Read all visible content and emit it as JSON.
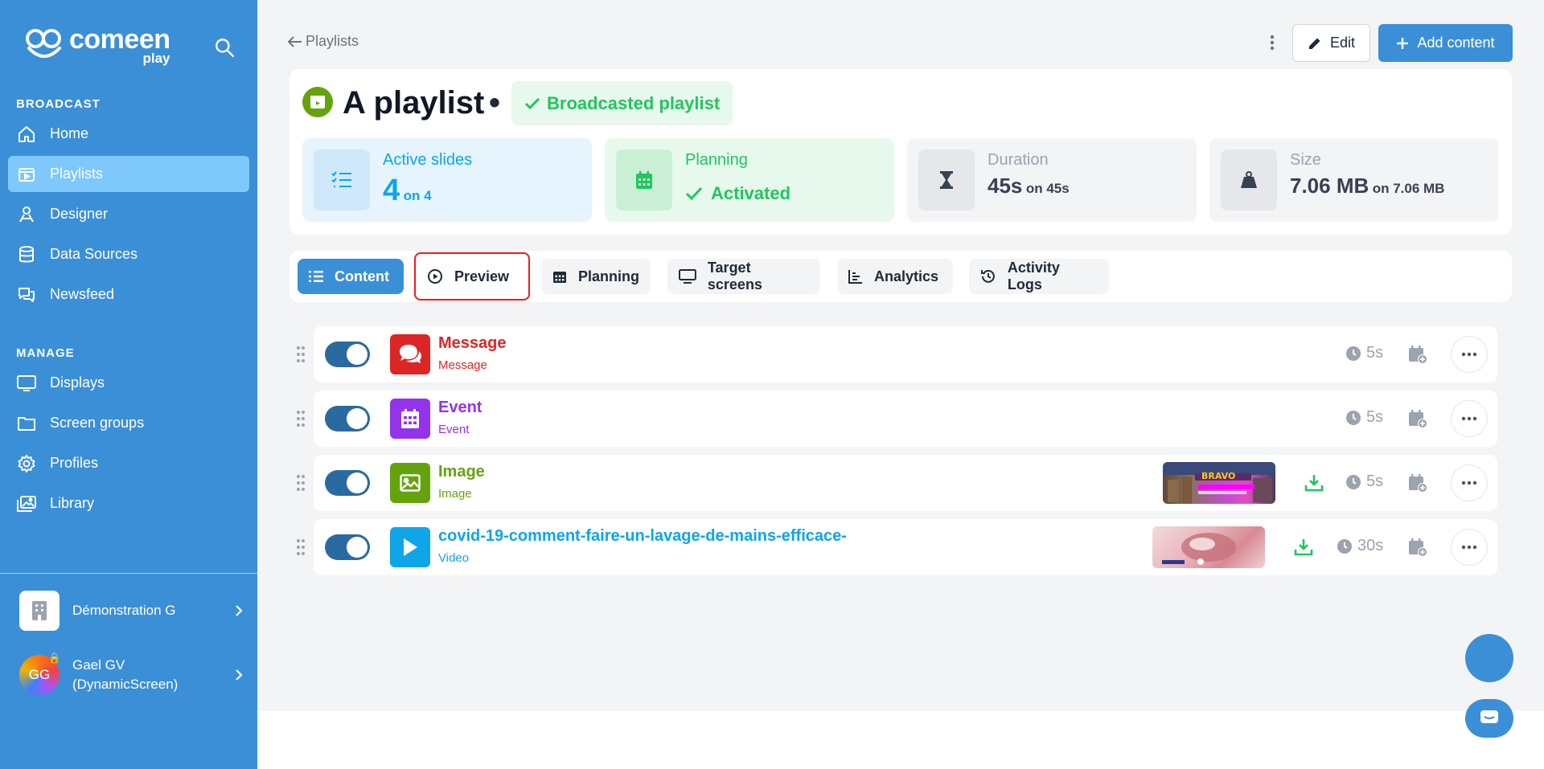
{
  "app": {
    "brand": "comeen",
    "brand_sub": "play"
  },
  "sidebar": {
    "broadcast_label": "BROADCAST",
    "manage_label": "MANAGE",
    "broadcast_items": [
      {
        "label": "Home",
        "icon": "home-icon"
      },
      {
        "label": "Playlists",
        "icon": "playlist-icon",
        "active": true
      },
      {
        "label": "Designer",
        "icon": "designer-icon"
      },
      {
        "label": "Data Sources",
        "icon": "database-icon"
      },
      {
        "label": "Newsfeed",
        "icon": "newsfeed-icon"
      }
    ],
    "manage_items": [
      {
        "label": "Displays",
        "icon": "monitor-icon"
      },
      {
        "label": "Screen groups",
        "icon": "folder-icon"
      },
      {
        "label": "Profiles",
        "icon": "gear-icon"
      },
      {
        "label": "Library",
        "icon": "images-icon"
      }
    ],
    "organization": "Démonstration G",
    "user": {
      "initials": "GG",
      "name_line1": "Gael GV",
      "name_line2": "(DynamicScreen)"
    }
  },
  "header": {
    "back_label": "Playlists",
    "edit_label": "Edit",
    "add_label": "Add content"
  },
  "playlist": {
    "title": "A playlist",
    "separator": "•",
    "status": "Broadcasted playlist",
    "stats": {
      "active": {
        "label": "Active slides",
        "value": "4",
        "suffix": "on 4"
      },
      "planning": {
        "label": "Planning",
        "value": "Activated"
      },
      "duration": {
        "label": "Duration",
        "value": "45s",
        "suffix": "on 45s"
      },
      "size": {
        "label": "Size",
        "value": "7.06 MB",
        "suffix": "on 7.06 MB"
      }
    }
  },
  "tabs": [
    {
      "label": "Content",
      "icon": "list-icon",
      "active": true
    },
    {
      "label": "Preview",
      "icon": "play-circle-icon",
      "highlighted": true
    },
    {
      "label": "Planning",
      "icon": "calendar-icon"
    },
    {
      "label": "Target screens",
      "icon": "monitor-icon"
    },
    {
      "label": "Analytics",
      "icon": "chart-icon"
    },
    {
      "label": "Activity Logs",
      "icon": "history-icon"
    }
  ],
  "slides": [
    {
      "title": "Message",
      "type": "Message",
      "duration": "5s",
      "color": "#dc2626",
      "icon": "comments-icon",
      "enabled": true
    },
    {
      "title": "Event",
      "type": "Event",
      "duration": "5s",
      "color": "#9333ea",
      "icon": "calendar-icon",
      "enabled": true
    },
    {
      "title": "Image",
      "type": "Image",
      "duration": "5s",
      "color": "#65a30d",
      "icon": "image-icon",
      "enabled": true,
      "thumbnail_text": "BRAVO"
    },
    {
      "title": "covid-19-comment-faire-un-lavage-de-mains-efficace-",
      "type": "Video",
      "duration": "30s",
      "color": "#0ea5e9",
      "icon": "play-icon",
      "enabled": true
    }
  ]
}
